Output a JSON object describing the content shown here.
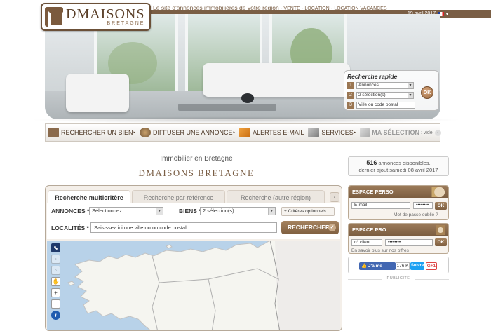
{
  "header": {
    "logo_name": "DMAISONS",
    "logo_sub": "BRETAGNE",
    "tagline": "Le site d'annonces immobilières de votre région",
    "links": [
      "- VENTE",
      "- LOCATION",
      "- LOCATION VACANCES"
    ],
    "date": "19 avril 2017",
    "lang_dropdown": "▾"
  },
  "quick_search": {
    "title": "Recherche rapide",
    "steps": [
      "1",
      "2",
      "3"
    ],
    "field1": "Annonces",
    "field2": "2 sélection(s)",
    "field3": "Ville ou code postal",
    "ok": "OK"
  },
  "nav": {
    "items": [
      "RECHERCHER UN BIEN",
      "DIFFUSER UNE ANNONCE",
      "ALERTES E-MAIL",
      "SERVICES",
      "MA SÉLECTION"
    ],
    "selection_state": ": vide",
    "info": "i",
    "arrow": "▸"
  },
  "titles": {
    "line1": "Immobilier en Bretagne",
    "line2": "Dmaisons bretagne"
  },
  "stats": {
    "count": "516",
    "count_label": " annonces disponibles,",
    "last_label": "dernier ajout samedi 08 avril 2017"
  },
  "search": {
    "tabs": [
      "Recherche multicritère",
      "Recherche par référence",
      "Recherche (autre région)"
    ],
    "info": "i",
    "annonces_label": "ANNONCES *",
    "annonces_value": "Sélectionnez",
    "biens_label": "BIENS *",
    "biens_value": "2 sélection(s)",
    "criteres": "+ Critères optionnels",
    "localites_label": "LOCALITÉS *",
    "localites_placeholder": "Saisissez ici une ville ou un code postal.",
    "button": "RECHERCHER",
    "check": "✓"
  },
  "map_controls": [
    "⬉",
    "◦",
    "◦",
    "✋",
    "+",
    "−",
    "i"
  ],
  "espace_perso": {
    "title": "ESPACE PERSO",
    "email_placeholder": "E-mail",
    "password_value": "••••••••",
    "ok": "OK",
    "forgot": "Mot de passe oublié ?"
  },
  "espace_pro": {
    "title": "ESPACE PRO",
    "client_placeholder": "n° client",
    "password_value": "••••••••",
    "ok": "OK",
    "more": "En savoir plus sur nos offres"
  },
  "social": {
    "like": "J'aime",
    "like_count": "176 K",
    "follow": "Suivre",
    "gplus": "G+1"
  },
  "publicite": "- PUBLICITÉ -",
  "colors": {
    "brand_brown": "#7a5e45",
    "sea": "#b8d2e9",
    "land": "#f5f5f0"
  }
}
